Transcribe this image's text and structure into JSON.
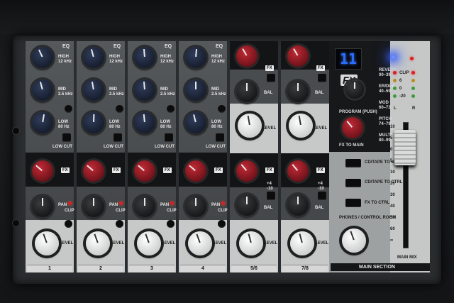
{
  "mono_channels": [
    {
      "number": "1"
    },
    {
      "number": "2"
    },
    {
      "number": "3"
    },
    {
      "number": "4"
    }
  ],
  "stereo_channels": [
    {
      "number": "5/6",
      "gain_values": [
        "+4",
        "-10"
      ]
    },
    {
      "number": "7/8",
      "gain_values": [
        "+4",
        "-10"
      ]
    }
  ],
  "labels": {
    "eq": "EQ",
    "high": "HIGH",
    "high_freq": "12 kHz",
    "mid": "MID",
    "mid_freq": "2.5 kHz",
    "low": "LOW",
    "low_freq": "80 Hz",
    "low_cut": "LOW CUT",
    "fx": "FX",
    "pan": "PAN",
    "clip": "CLIP",
    "level": "LEVEL",
    "bal": "BAL"
  },
  "main_section": {
    "title": "MAIN SECTION",
    "fx_display": "11",
    "fx_logo": "FX",
    "program_label": "PROGRAM (PUSH)",
    "fx_to_main": "FX TO MAIN",
    "presets": [
      {
        "name": "REVERB",
        "range": "00–39"
      },
      {
        "name": "ER/DLY",
        "range": "40–59"
      },
      {
        "name": "MOD",
        "range": "60–73"
      },
      {
        "name": "PITCH",
        "range": "74–79"
      },
      {
        "name": "MULTI",
        "range": "80–99"
      }
    ],
    "meter_labels": [
      "CLIP",
      "6",
      "0",
      "-20"
    ],
    "meter_lr": [
      "L",
      "R"
    ],
    "cd_tape_to_mix": "CD/TAPE TO MIX",
    "cd_tape_to_ctrl": "CD/TAPE TO CTRL",
    "fx_to_ctrl": "FX TO CTRL",
    "phones_label": "PHONES / CONTROL ROOM",
    "main_mix_label": "MAIN MIX",
    "fader_scale": [
      "10",
      "5",
      "0",
      "5",
      "10",
      "20",
      "30",
      "40",
      "50",
      "60",
      "∞"
    ]
  },
  "colors": {
    "eq_knob": "#1f2a44",
    "fx_knob": "#a4222c",
    "level_knob": "#ffffff",
    "display": "#2c6dff",
    "power_led": "#2f5bff"
  }
}
